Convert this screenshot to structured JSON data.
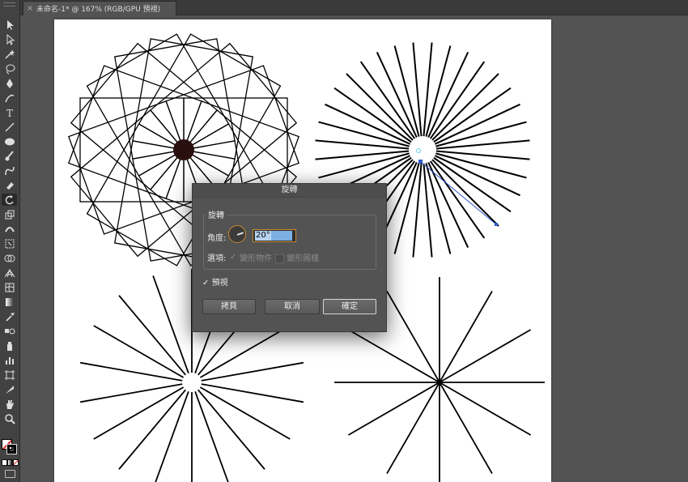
{
  "tab": {
    "close_glyph": "×",
    "title": "未命名-1* @ 167% (RGB/GPU 預視)"
  },
  "toolbar": {
    "tools": [
      "selection-tool",
      "direct-selection-tool",
      "magic-wand-tool",
      "lasso-tool",
      "pen-tool",
      "curvature-tool",
      "type-tool",
      "line-tool",
      "ellipse-tool",
      "paintbrush-tool",
      "shaper-tool",
      "eraser-tool",
      "rotate-tool",
      "scale-tool",
      "width-tool",
      "free-transform-tool",
      "shape-builder-tool",
      "perspective-grid-tool",
      "mesh-tool",
      "gradient-tool",
      "eyedropper-tool",
      "blend-tool",
      "symbol-sprayer-tool",
      "column-graph-tool",
      "artboard-tool",
      "slice-tool",
      "hand-tool",
      "zoom-tool"
    ],
    "active_tool": "rotate-tool"
  },
  "dialog": {
    "title": "旋轉",
    "group_label": "旋轉",
    "angle_label": "角度:",
    "angle_value": "20°",
    "options_label": "選項:",
    "transform_objects": "變形物件",
    "transform_patterns": "變形圖樣",
    "preview_label": "預視",
    "preview_checked": true,
    "copy_button": "拷貝",
    "cancel_button": "取消",
    "ok_button": "確定",
    "angle_degrees": 20
  },
  "colors": {
    "fill": "#ffffff",
    "stroke": "#000000",
    "none_slash": "#e02020",
    "accent_field": "#c98a2e",
    "selection_blue": "#2f59c9"
  }
}
